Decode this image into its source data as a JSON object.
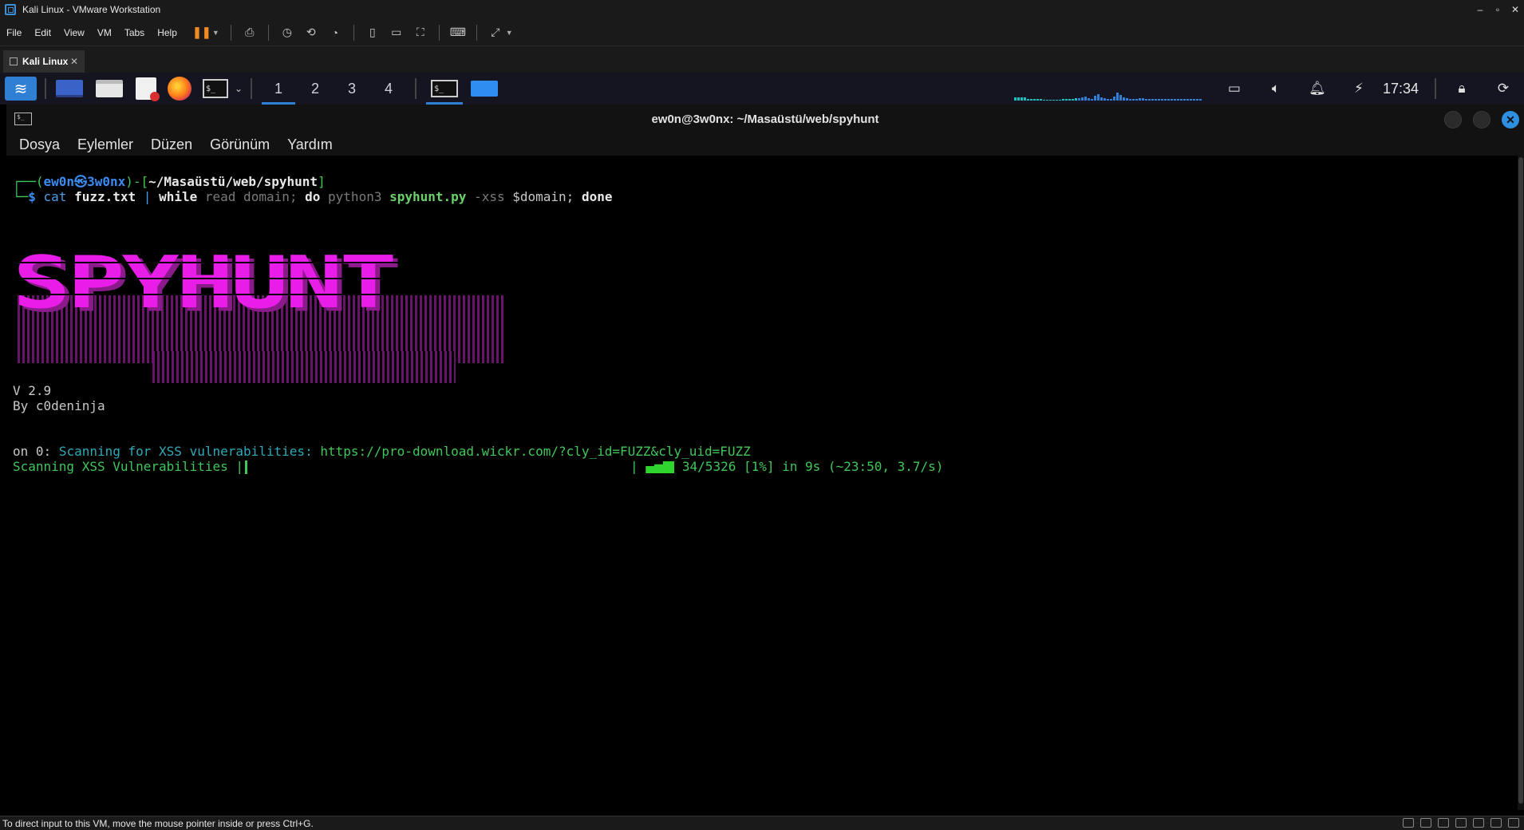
{
  "vmware": {
    "window_title": "Kali Linux - VMware Workstation",
    "menu": [
      "File",
      "Edit",
      "View",
      "VM",
      "Tabs",
      "Help"
    ],
    "tab_label": "Kali Linux",
    "tab_close": "✕",
    "status_text": "To direct input to this VM, move the mouse pointer inside or press Ctrl+G."
  },
  "kali_panel": {
    "workspaces": [
      "1",
      "2",
      "3",
      "4"
    ],
    "clock": "17:34",
    "icons": [
      "kali-menu-icon",
      "show-desktop-icon",
      "file-manager-icon",
      "text-editor-icon",
      "firefox-icon",
      "terminal-icon",
      "display-icon",
      "volume-icon",
      "notifications-icon",
      "update-icon",
      "lock-icon",
      "logout-icon"
    ]
  },
  "terminal": {
    "title": "ew0n@3w0nx: ~/Masaüstü/web/spyhunt",
    "menu": [
      "Dosya",
      "Eylemler",
      "Düzen",
      "Görünüm",
      "Yardım"
    ],
    "prompt": {
      "corner_top": "┌──(",
      "user_host": "ew0n㉿3w0nx",
      "mid": ")-[",
      "cwd": "~/Masaüstü/web/spyhunt",
      "end": "]",
      "corner_bottom": "└─",
      "dollar": "$"
    },
    "command": {
      "cat": "cat",
      "file": "fuzz.txt",
      "pipe": "|",
      "while": "while",
      "read": "read domain;",
      "do": "do",
      "python": "python3",
      "script": "spyhunt.py",
      "flag": "-xss",
      "var": "$domain;",
      "done": "done"
    },
    "banner_text": "SPYHUNT",
    "version": "V 2.9",
    "author": "By c0deninja",
    "scan_prefix": "on 0:",
    "scan_label": "Scanning for XSS vulnerabilities:",
    "scan_url": "https://pro-download.wickr.com/?cly_id=FUZZ&cly_uid=FUZZ",
    "progress_label": "Scanning XSS Vulnerabilities |",
    "progress_sep": "|",
    "progress_stats": "34/5326 [1%] in 9s (~23:50, 3.7/s)",
    "progress_fraction": 0.01
  },
  "colors": {
    "banner": "#e81ee8",
    "prompt_green": "#3fc75a",
    "path_blue": "#3a8cf2",
    "kali_blue": "#2f7fd5"
  }
}
